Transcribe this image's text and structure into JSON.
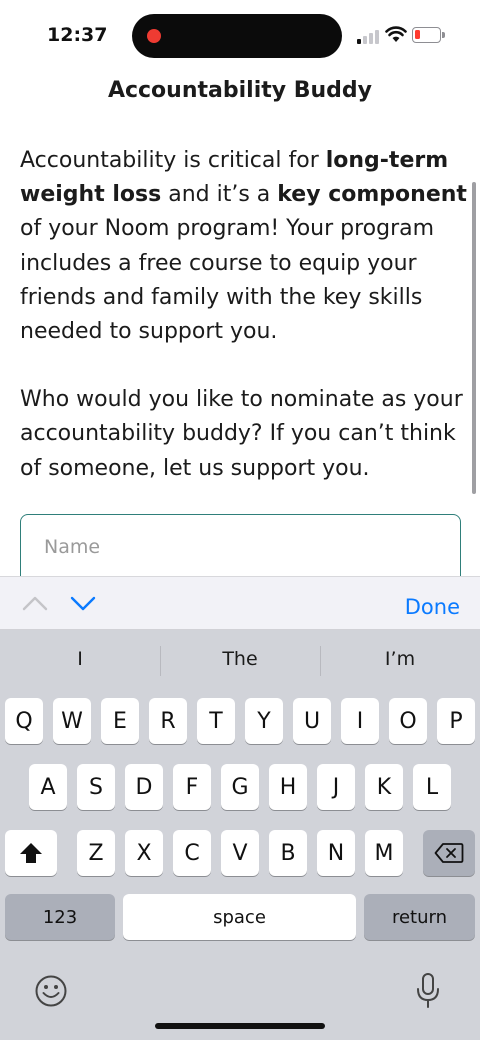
{
  "status_bar": {
    "time": "12:37"
  },
  "title": "Accountability Buddy",
  "body": {
    "p1_pre": "Accountability is critical for ",
    "p1_bold1": "long-term weight loss",
    "p1_mid": " and it’s a ",
    "p1_bold2": "key component",
    "p1_post": " of your Noom program! Your program includes a free course to equip your friends and family with the key skills needed to support you.",
    "p2": "Who would you like to nominate as your accountability buddy? If you can’t think of someone, let us support you."
  },
  "name_input": {
    "placeholder": "Name",
    "value": ""
  },
  "accessory": {
    "done_label": "Done"
  },
  "keyboard": {
    "suggestions": [
      "I",
      "The",
      "I’m"
    ],
    "row1": [
      "Q",
      "W",
      "E",
      "R",
      "T",
      "Y",
      "U",
      "I",
      "O",
      "P"
    ],
    "row2": [
      "A",
      "S",
      "D",
      "F",
      "G",
      "H",
      "J",
      "K",
      "L"
    ],
    "row3": [
      "Z",
      "X",
      "C",
      "V",
      "B",
      "N",
      "M"
    ],
    "numbers_label": "123",
    "space_label": "space",
    "return_label": "return"
  },
  "icons": {
    "shift": "shift-icon",
    "delete": "backspace-icon",
    "emoji": "emoji-icon",
    "mic": "microphone-icon"
  },
  "colors": {
    "accent_teal": "#2f7f7a",
    "ios_blue": "#0a7aff",
    "battery_low": "#ff3b30"
  }
}
